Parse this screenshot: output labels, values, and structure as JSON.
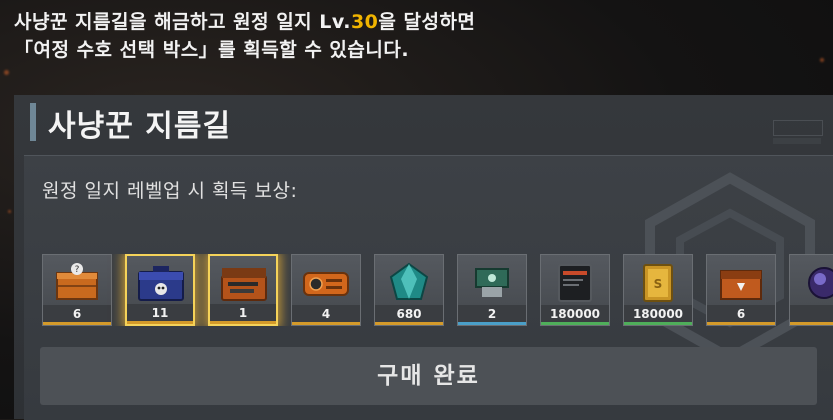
{
  "banner": {
    "line1_prefix": "사냥꾼 지름길을 해금하고 원정 일지 Lv.",
    "line1_level": "30",
    "line1_suffix": "을 달성하면",
    "line2": "「여정 수호 선택 박스」를 획득할 수 있습니다."
  },
  "panel": {
    "title": "사냥꾼 지름길",
    "reward_label": "원정 일지 레벨업 시 획득 보상:"
  },
  "rewards": [
    {
      "icon": "orange-mystery-crate-icon",
      "qty": "6",
      "selected": false,
      "strip": "#d49a2a"
    },
    {
      "icon": "blue-skull-chest-icon",
      "qty": "11",
      "selected": true,
      "strip": "#d49a2a"
    },
    {
      "icon": "orange-weapon-case-icon",
      "qty": "1",
      "selected": true,
      "strip": "#d49a2a"
    },
    {
      "icon": "orange-gadget-module-icon",
      "qty": "4",
      "selected": false,
      "strip": "#d49a2a"
    },
    {
      "icon": "teal-crystal-icon",
      "qty": "680",
      "selected": false,
      "strip": "#d49a2a"
    },
    {
      "icon": "green-usb-chip-icon",
      "qty": "2",
      "selected": false,
      "strip": "#4a9fc8"
    },
    {
      "icon": "black-card-ticket-icon",
      "qty": "180000",
      "selected": false,
      "strip": "#4fae5a"
    },
    {
      "icon": "gold-bar-icon",
      "qty": "180000",
      "selected": false,
      "strip": "#4fae5a"
    },
    {
      "icon": "orange-supply-box-icon",
      "qty": "6",
      "selected": false,
      "strip": "#d49a2a"
    },
    {
      "icon": "purple-orb-icon",
      "qty": "",
      "selected": false,
      "strip": "#d49a2a"
    }
  ],
  "buy_button": {
    "label": "구매 완료"
  },
  "colors": {
    "accent_level": "#f0b400",
    "selected_glow": "#f5d35a"
  }
}
